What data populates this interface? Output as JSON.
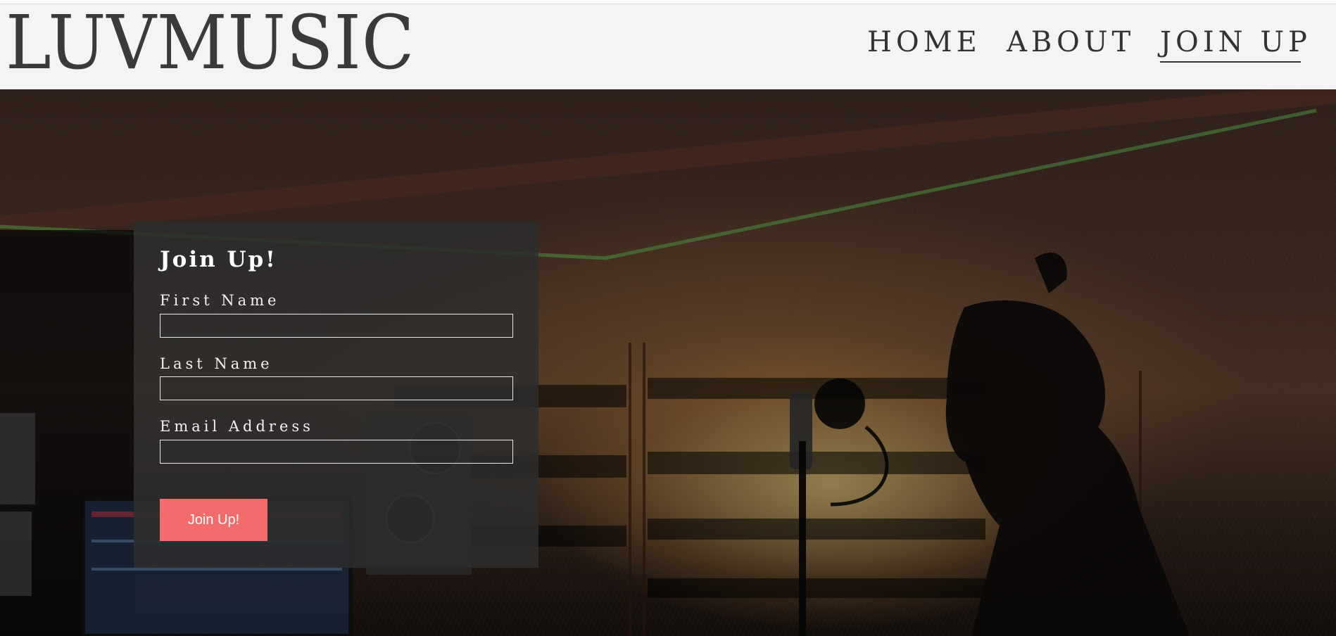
{
  "site": {
    "logo": "LUVMUSIC"
  },
  "nav": {
    "items": [
      {
        "label": "HOME"
      },
      {
        "label": "ABOUT"
      },
      {
        "label": "JOIN UP",
        "active": true
      }
    ]
  },
  "form": {
    "title": "Join Up!",
    "fields": [
      {
        "label": "First Name",
        "value": ""
      },
      {
        "label": "Last Name",
        "value": ""
      },
      {
        "label": "Email Address",
        "value": ""
      }
    ],
    "submit_label": "Join Up!"
  },
  "colors": {
    "header_bg": "#f4f4f4",
    "text_dark": "#333333",
    "panel_bg": "#2d2d2d",
    "button_accent": "#f26b6d"
  }
}
